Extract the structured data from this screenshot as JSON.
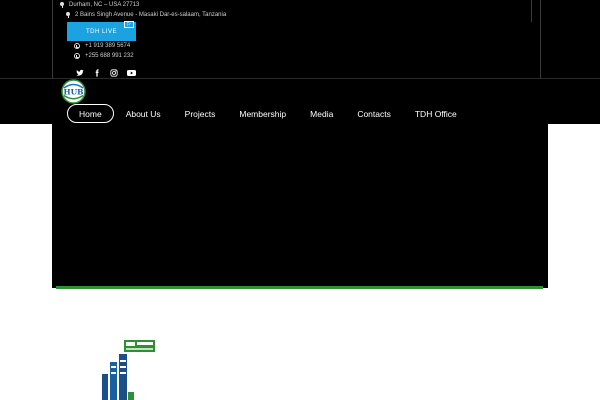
{
  "topbar": {
    "address_us": "Durham, NC – USA 27713",
    "address_tz": "2 Bains Singh Avenue - Masaki Dar-es-salaam, Tanzania",
    "live_button": "TDH LIVE",
    "live_badge": "▷",
    "phone_us": "+1 919 389 5674",
    "phone_tz": "+255 688 991 232",
    "socials": [
      "twitter-icon",
      "facebook-icon",
      "instagram-icon",
      "youtube-icon"
    ]
  },
  "logo": {
    "text": "HUB"
  },
  "nav": {
    "items": [
      {
        "label": "Home",
        "active": true
      },
      {
        "label": "About Us"
      },
      {
        "label": "Projects"
      },
      {
        "label": "Membership"
      },
      {
        "label": "Media"
      },
      {
        "label": "Contacts"
      },
      {
        "label": "TDH Office"
      }
    ]
  },
  "colors": {
    "background": "#000000",
    "accent_blue": "#1aa3e0",
    "accent_green": "#2e8f33"
  }
}
